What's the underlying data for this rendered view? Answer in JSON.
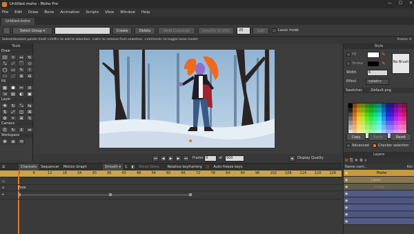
{
  "window": {
    "title": "Untitled.moho - Moho Pro",
    "min": "—",
    "max": "☐",
    "close": "✕"
  },
  "menu": [
    "File",
    "Edit",
    "Draw",
    "Bone",
    "Animation",
    "Scripts",
    "View",
    "Window",
    "Help"
  ],
  "doc_tab": "Untitled.moho",
  "tool_options": {
    "select_group": "Select Group",
    "create": "Create",
    "delete": "Delete",
    "weld": "Weld Crossings",
    "simplify": "Simplify (0-100)",
    "simplify_value": "25",
    "split": "Split",
    "lasso": "Lasso mode"
  },
  "hint": "Select/deselect points (hold <shift> to add to selection, <alt> to remove from selection, <ctrl/cmd> to toggle lasso mode)",
  "frame_indicator": "Frame: 0",
  "tools": {
    "header": "Tools",
    "draw_label": "Draw",
    "draw": [
      "⬚",
      "+",
      "↔",
      "↻",
      "⤡",
      "⟋",
      "⌒",
      "◇",
      "◯",
      "▭",
      "✎",
      "⌇",
      "⋯",
      "⋰",
      "⊕",
      "⊖"
    ],
    "fill_label": "Fill",
    "fill": [
      "▦",
      "⬢",
      "✂",
      "⊘",
      "⇲",
      "▤",
      "◐",
      "▣"
    ],
    "layer_label": "Layer",
    "layer": [
      "✥",
      "↻",
      "⤡",
      "⇆",
      "⇅",
      "⤢",
      "◫",
      "⌘",
      "✿",
      "⌖",
      "⊞",
      "↯"
    ],
    "camera_label": "Camera",
    "camera": [
      "⎘",
      "↻",
      "⇕",
      "⇔"
    ],
    "workspace_label": "Workspace",
    "workspace": [
      "✥",
      "⊕",
      "⟲"
    ]
  },
  "frame_bar": {
    "frame_label": "Frame",
    "frame_value": "0",
    "of_label": "of",
    "total": "500",
    "display_quality": "Display Quality"
  },
  "style": {
    "header": "Style",
    "fill": "Fill",
    "stroke": "Stroke",
    "width": "Width",
    "width_value": "6",
    "no_brush": "No Brush",
    "effect": "Effect",
    "effect_value": "<plain>",
    "swatches_label": "Swatches",
    "swatch_file": ".Default.png",
    "copy": "Copy",
    "paste": "Paste",
    "reset": "Reset",
    "advanced": "Advanced",
    "checker": "Checker selection",
    "fill_color": "#ffffff",
    "stroke_color": "#000000"
  },
  "layers": {
    "header": "Layers",
    "name_col": "Name cont...",
    "kind_col": "Kin",
    "rows": [
      {
        "name": "Matte",
        "color": "#d4a23a"
      },
      {
        "name": "Layer",
        "color": "#9a8660"
      },
      {
        "name": "Group",
        "color": "#6d6a5c"
      },
      {
        "name": "",
        "color": "#5b628f"
      },
      {
        "name": "",
        "color": "#5b628f"
      },
      {
        "name": "",
        "color": "#5b628f"
      },
      {
        "name": "",
        "color": "#5b628f"
      },
      {
        "name": "",
        "color": "#5b628f"
      }
    ]
  },
  "timeline": {
    "tabs": [
      "Channels",
      "Sequencer",
      "Motion Graph"
    ],
    "smooth": "Smooth",
    "smooth_val": "1",
    "onion": "Onion Skins",
    "relative": "Relative keyframing",
    "autofreeze": "Auto-freeze keys",
    "ruler": [
      "0",
      "6",
      "12",
      "18",
      "24",
      "30",
      "36",
      "42",
      "48",
      "54",
      "60",
      "66",
      "72",
      "78",
      "84",
      "90",
      "96",
      "102",
      "108",
      "114",
      "120",
      "126"
    ],
    "row_label": "Pose"
  },
  "colors": {
    "accent": "#e07a22",
    "ruler": "#c9a34d",
    "sky": "#7ea6c8",
    "snow": "#e6eef6"
  }
}
